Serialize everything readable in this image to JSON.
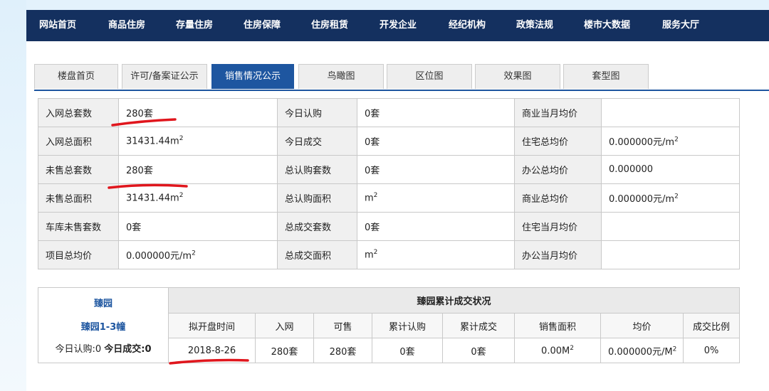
{
  "nav": [
    "网站首页",
    "商品住房",
    "存量住房",
    "住房保障",
    "住房租赁",
    "开发企业",
    "经纪机构",
    "政策法规",
    "楼市大数据",
    "服务大厅"
  ],
  "tabs": [
    "楼盘首页",
    "许可/备案证公示",
    "销售情况公示",
    "鸟瞰图",
    "区位图",
    "效果图",
    "套型图"
  ],
  "active_tab": "销售情况公示",
  "info": [
    [
      "入网总套数",
      "280套",
      "今日认购",
      "0套",
      "商业当月均价",
      ""
    ],
    [
      "入网总面积",
      "31431.44m",
      "今日成交",
      "0套",
      "住宅总均价",
      "0.000000元/m"
    ],
    [
      "未售总套数",
      "280套",
      "总认购套数",
      "0套",
      "办公总均价",
      "0.000000"
    ],
    [
      "未售总面积",
      "31431.44m",
      "总认购面积",
      "m",
      "商业总均价",
      "0.000000元/m"
    ],
    [
      "车库未售套数",
      "0套",
      "总成交套数",
      "0套",
      "住宅当月均价",
      ""
    ],
    [
      "项目总均价",
      "0.000000元/m",
      "总成交面积",
      "m",
      "办公当月均价",
      ""
    ]
  ],
  "sup": "2",
  "summary": {
    "project": "臻园",
    "building": "臻园1-3幢",
    "today_rg_label": "今日认购:0",
    "today_cj_label": "今日成交:0",
    "title": "臻园累计成交状况",
    "headers": [
      "拟开盘时间",
      "入网",
      "可售",
      "累计认购",
      "累计成交",
      "销售面积",
      "均价",
      "成交比例"
    ],
    "row": [
      "2018-8-26",
      "280套",
      "280套",
      "0套",
      "0套",
      "0.00M",
      "0.000000元/M",
      "0%"
    ]
  },
  "annotation_color": "#e0161d"
}
